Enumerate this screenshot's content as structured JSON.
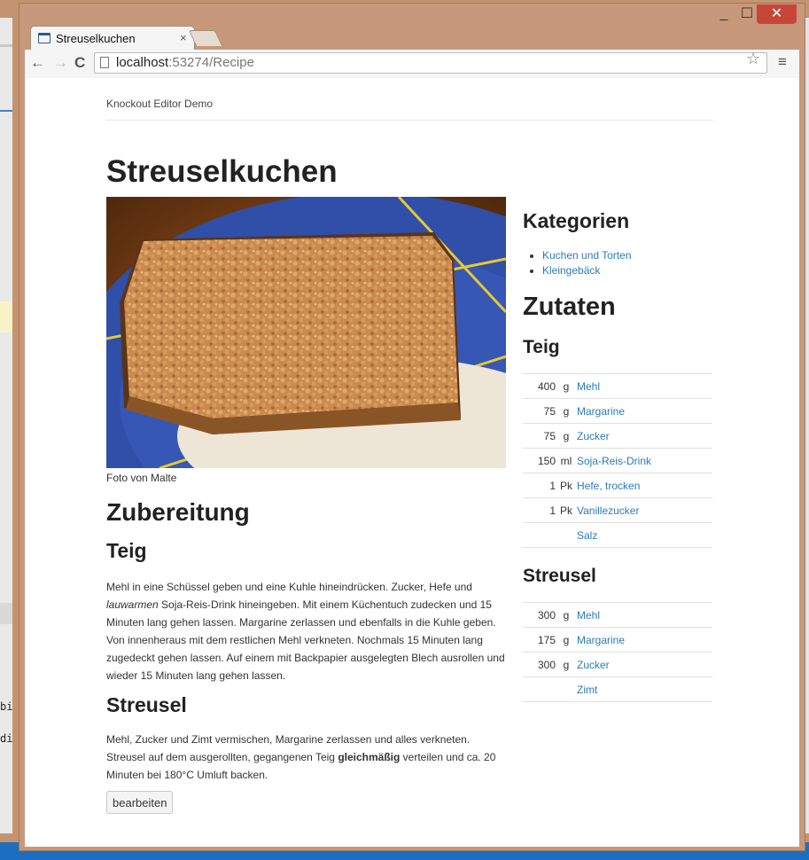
{
  "browser": {
    "tab_title": "Streuselkuchen",
    "tab_close": "×",
    "url_host": "localhost",
    "url_port": ":53274",
    "url_path": "/Recipe",
    "back": "←",
    "forward": "→",
    "reload": "C",
    "star": "☆",
    "menu": "≡",
    "minimize": "_",
    "maximize": "☐",
    "close": "✕"
  },
  "background_code": [
    "bi",
    "di"
  ],
  "page": {
    "brand": "Knockout Editor Demo",
    "title": "Streuselkuchen",
    "photo_caption": "Foto von Malte",
    "preparation_heading": "Zubereitung",
    "sections": [
      {
        "heading": "Teig",
        "text_before": "Mehl in eine Schüssel geben und eine Kuhle hineindrücken. Zucker, Hefe und ",
        "emphasis": "lauwarmen",
        "text_after": " Soja-Reis-Drink hineingeben. Mit einem Küchentuch zudecken und 15 Minuten lang gehen lassen. Margarine zerlassen und ebenfalls in die Kuhle geben. Von innenheraus mit dem restlichen Mehl verkneten. Nochmals 15 Minuten lang zugedeckt gehen lassen. Auf einem mit Backpapier ausgelegten Blech ausrollen und wieder 15 Minuten lang gehen lassen."
      },
      {
        "heading": "Streusel",
        "text_before": "Mehl, Zucker und Zimt vermischen, Margarine zerlassen und alles verkneten. Streusel auf dem ausgerollten, gegangenen Teig ",
        "strong": "gleichmäßig",
        "text_after": " verteilen und ca. 20 Minuten bei 180°C Umluft backen."
      }
    ],
    "edit_button": "bearbeiten",
    "categories_heading": "Kategorien",
    "categories": [
      "Kuchen und Torten",
      "Kleingebäck"
    ],
    "ingredients_heading": "Zutaten",
    "ingredient_groups": [
      {
        "heading": "Teig",
        "items": [
          {
            "amount": "400",
            "unit": "g",
            "name": "Mehl"
          },
          {
            "amount": "75",
            "unit": "g",
            "name": "Margarine"
          },
          {
            "amount": "75",
            "unit": "g",
            "name": "Zucker"
          },
          {
            "amount": "150",
            "unit": "ml",
            "name": "Soja-Reis-Drink"
          },
          {
            "amount": "1",
            "unit": "Pk",
            "name": "Hefe, trocken"
          },
          {
            "amount": "1",
            "unit": "Pk",
            "name": "Vanillezucker"
          },
          {
            "amount": "",
            "unit": "",
            "name": "Salz"
          }
        ]
      },
      {
        "heading": "Streusel",
        "items": [
          {
            "amount": "300",
            "unit": "g",
            "name": "Mehl"
          },
          {
            "amount": "175",
            "unit": "g",
            "name": "Margarine"
          },
          {
            "amount": "300",
            "unit": "g",
            "name": "Zucker"
          },
          {
            "amount": "",
            "unit": "",
            "name": "Zimt"
          }
        ]
      }
    ]
  },
  "colors": {
    "link": "#2b7bb9",
    "window_frame": "#c8987a",
    "close_button": "#c7463a"
  }
}
